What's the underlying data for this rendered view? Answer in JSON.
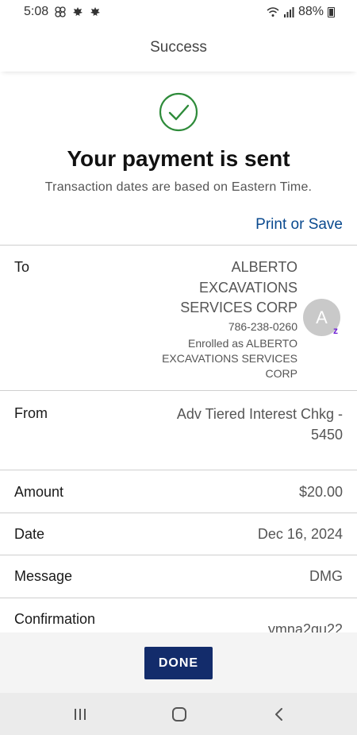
{
  "status_bar": {
    "time": "5:08",
    "battery": "88%",
    "icons": [
      "pinwheel-icon",
      "maple-leaf-icon",
      "maple-leaf-icon",
      "wifi-icon",
      "signal-icon",
      "battery-icon"
    ]
  },
  "header": {
    "title": "Success"
  },
  "confirmation": {
    "icon": "check-circle-icon",
    "title": "Your payment is sent",
    "subtitle": "Transaction dates are based on Eastern Time.",
    "print_label": "Print or Save"
  },
  "details": {
    "to_label": "To",
    "to_name": "ALBERTO EXCAVATIONS SERVICES CORP",
    "to_phone": "786-238-0260",
    "to_enrolled": "Enrolled as ALBERTO EXCAVATIONS SERVICES CORP",
    "avatar_initial": "A",
    "from_label": "From",
    "from_value": "Adv Tiered Interest Chkg - 5450",
    "amount_label": "Amount",
    "amount_value": "$20.00",
    "date_label": "Date",
    "date_value": "Dec 16, 2024",
    "message_label": "Message",
    "message_value": "DMG",
    "confirmation_label": "Confirmation",
    "confirmation_value": "ymna2qu22"
  },
  "footer": {
    "done_label": "DONE"
  },
  "colors": {
    "accent": "#0a4a8f",
    "success": "#2e8b3a",
    "button": "#132c6b",
    "zelle": "#6d1ed4"
  }
}
